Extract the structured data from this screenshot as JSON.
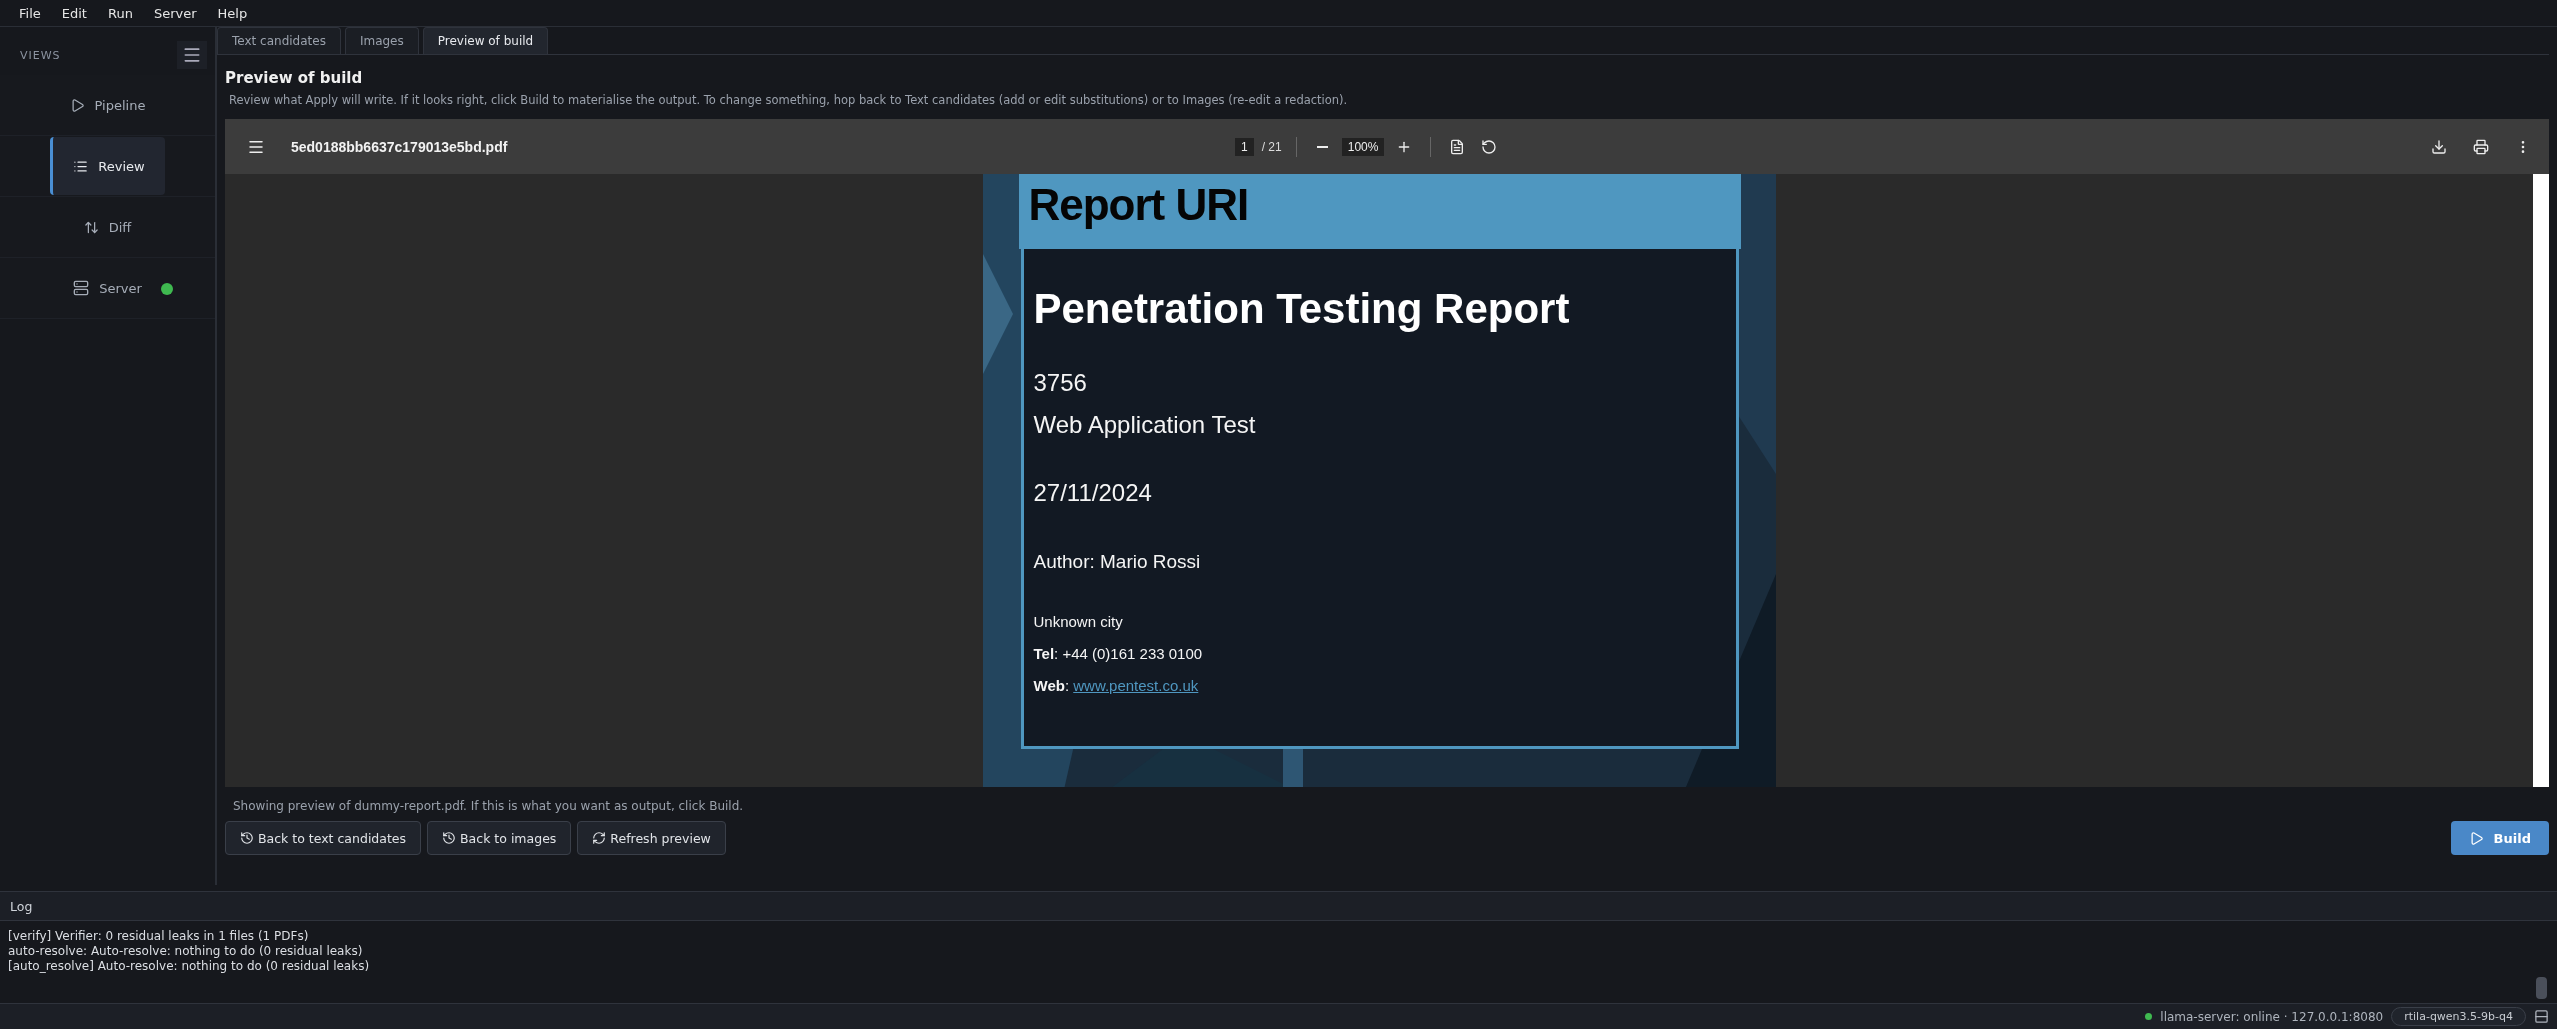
{
  "menu": [
    "File",
    "Edit",
    "Run",
    "Server",
    "Help"
  ],
  "sidebar": {
    "title": "VIEWS",
    "items": [
      {
        "label": "Pipeline",
        "selected": false
      },
      {
        "label": "Review",
        "selected": true
      },
      {
        "label": "Diff",
        "selected": false
      },
      {
        "label": "Server",
        "selected": false,
        "color": "#3fb950"
      }
    ]
  },
  "tabs": [
    {
      "label": "Text candidates",
      "selected": false
    },
    {
      "label": "Images",
      "selected": false
    },
    {
      "label": "Preview of build",
      "selected": true
    }
  ],
  "heading": "Preview of build",
  "description": "Review what Apply will write. If it looks right, click Build to materialise the output. To change something, hop back to Text candidates (add or edit substitutions) or to Images (re-edit a redaction).",
  "viewer": {
    "filename": "5ed0188bb6637c179013e5bd.pdf",
    "page": "1",
    "pages": "/ 21",
    "zoom": "100%",
    "document": {
      "banner": "Report URI",
      "title": "Penetration Testing Report",
      "number": "3756",
      "subtitle": "Web Application Test",
      "date": "27/11/2024",
      "author": "Author: Mario Rossi",
      "city": "Unknown city",
      "tel": "**Tel**: +44 (0)161 233 0100",
      "web_label": "**Web**: ",
      "web_link": "www.pentest.co.uk"
    }
  },
  "footer_note": "Showing preview of dummy-report.pdf.  If this is what you want as output, click Build.",
  "actions": [
    {
      "label": "Back to text candidates"
    },
    {
      "label": "Back to images"
    },
    {
      "label": "Refresh preview"
    }
  ],
  "build_button": "Build",
  "log": {
    "title": "Log",
    "lines": [
      "[verify] Verifier: 0 residual leaks in 1 files (1 PDFs)",
      "auto-resolve: Auto-resolve: nothing to do (0 residual leaks)",
      "[auto_resolve] Auto-resolve: nothing to do (0 residual leaks)"
    ]
  },
  "status": {
    "server": "llama-server: online · 127.0.0.1:8080",
    "color": "#3fb950",
    "model": "rtila-qwen3.5-9b-q4"
  }
}
